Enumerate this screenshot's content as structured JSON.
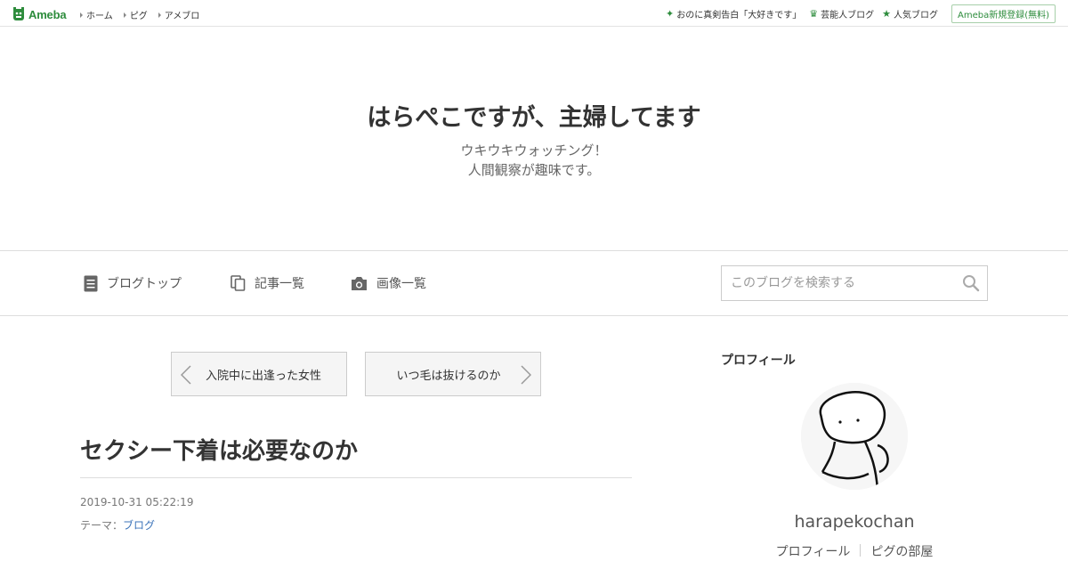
{
  "topbar": {
    "logo_text": "Ameba",
    "nav": [
      "ホーム",
      "ピグ",
      "アメブロ"
    ],
    "links": [
      {
        "icon": "sparkle-icon",
        "label": "おのに真剣告白「大好きです」"
      },
      {
        "icon": "crown-icon",
        "label": "芸能人ブログ"
      },
      {
        "icon": "star-icon",
        "label": "人気ブログ"
      }
    ],
    "signup_label": "Ameba新規登録(無料)"
  },
  "header": {
    "title": "はらぺこですが、主婦してます",
    "description_line1": "ウキウキウォッチング！",
    "description_line2": "人間観察が趣味です。"
  },
  "nav": {
    "blog_top": "ブログトップ",
    "entry_list": "記事一覧",
    "image_list": "画像一覧",
    "search_placeholder": "このブログを検索する"
  },
  "article": {
    "prev_label": "入院中に出逢った女性",
    "next_label": "いつ毛は抜けるのか",
    "title": "セクシー下着は必要なのか",
    "date": "2019-10-31 05:22:19",
    "theme_prefix": "テーマ：",
    "theme_link": "ブログ"
  },
  "sidebar": {
    "heading": "プロフィール",
    "username": "harapekochan",
    "links": [
      "プロフィール",
      "ピグの部屋"
    ]
  },
  "colors": {
    "brand_green": "#2d8c3c",
    "link_blue": "#3b73b9"
  }
}
